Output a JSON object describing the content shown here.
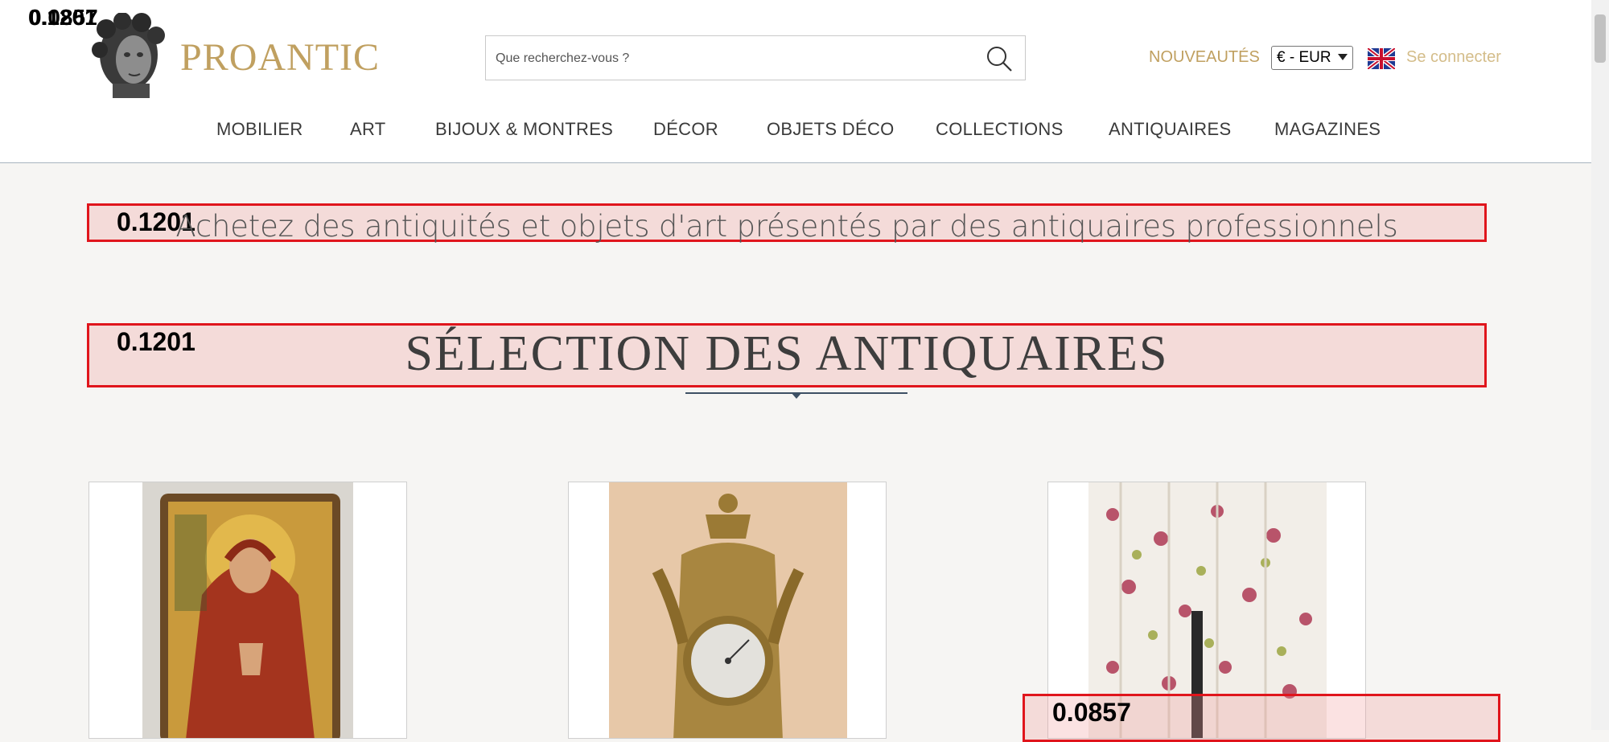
{
  "header": {
    "logo_text": "PROANTIC",
    "search_placeholder": "Que recherchez-vous ?",
    "nouveautes_label": "NOUVEAUTÉS",
    "currency": "€ - EUR",
    "login_label": "Se connecter"
  },
  "nav": {
    "items": [
      "MOBILIER",
      "ART",
      "BIJOUX & MONTRES",
      "DÉCOR",
      "OBJETS DÉCO",
      "COLLECTIONS",
      "ANTIQUAIRES",
      "MAGAZINES"
    ]
  },
  "main": {
    "tagline": "Achetez des antiquités et objets d'art présentés par des antiquaires professionnels",
    "section_title": "SÉLECTION DES ANTIQUAIRES"
  },
  "overlays": {
    "logo_score": "0.0857",
    "logo_score_shadow": "0.1201",
    "tagline_score": "0.1201",
    "section_score": "0.1201",
    "bottom_score": "0.0857"
  },
  "colors": {
    "brand_gold": "#c0a060",
    "overlay_red": "#e0151c"
  }
}
